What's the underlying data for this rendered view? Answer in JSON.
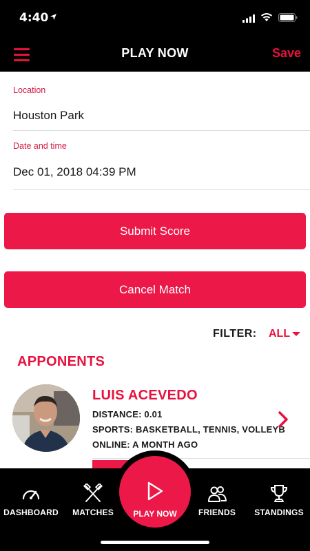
{
  "status_bar": {
    "time": "4:40"
  },
  "nav": {
    "title": "PLAY NOW",
    "save_label": "Save"
  },
  "form": {
    "location_label": "Location",
    "location_value": "Houston Park",
    "datetime_label": "Date and time",
    "datetime_value": "Dec 01, 2018 04:39 PM"
  },
  "buttons": {
    "submit_score": "Submit Score",
    "cancel_match": "Cancel Match"
  },
  "filter": {
    "label": "FILTER:",
    "value": "ALL"
  },
  "opponents": {
    "title": "APPONENTS",
    "players": [
      {
        "name": "LUIS ACEVEDO",
        "distance": "DISTANCE: 0.01",
        "sports": "SPORTS: BASKETBALL, TENNIS, VOLLEYB",
        "online": "ONLINE: A MONTH AGO"
      }
    ]
  },
  "tabs": [
    {
      "label": "DASHBOARD",
      "icon": "speedometer-icon"
    },
    {
      "label": "MATCHES",
      "icon": "crossed-rackets-icon"
    },
    {
      "label": "PLAY NOW",
      "icon": "play-icon"
    },
    {
      "label": "FRIENDS",
      "icon": "friends-icon"
    },
    {
      "label": "STANDINGS",
      "icon": "trophy-icon"
    }
  ],
  "colors": {
    "accent": "#ec1848",
    "background": "#ffffff",
    "bar": "#000000"
  }
}
